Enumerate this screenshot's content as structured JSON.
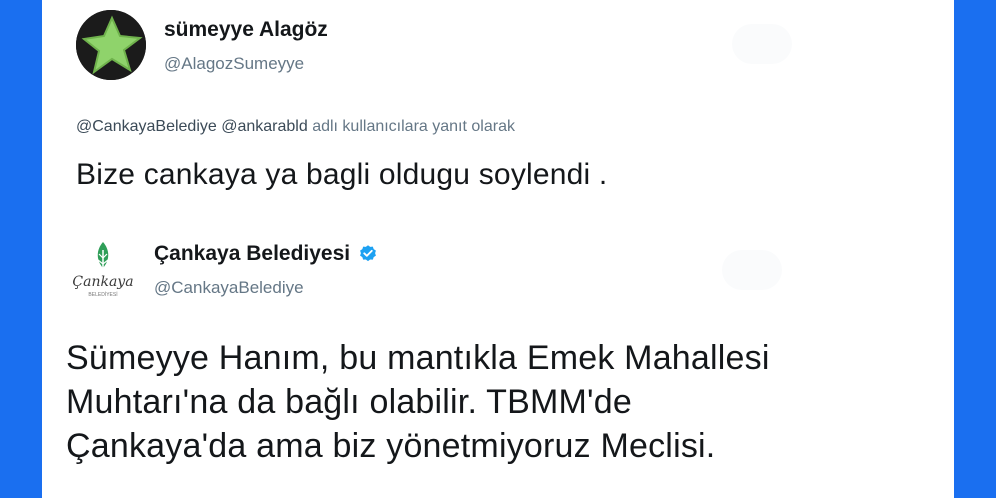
{
  "colors": {
    "frame_bg": "#1a6ff0",
    "text": "#14171a",
    "muted": "#657786",
    "verified": "#1da1f2",
    "logo_green": "#2f9e58"
  },
  "tweet1": {
    "name": "sümeyye Alagöz",
    "handle": "@AlagozSumeyye",
    "reply_mentions": "@CankayaBelediye @ankarabld",
    "reply_suffix": "adlı kullanıcılara yanıt olarak",
    "text": "Bize cankaya ya bagli oldugu soylendi ."
  },
  "tweet2": {
    "name": "Çankaya Belediyesi",
    "verified_icon": "verified-badge-icon",
    "handle": "@CankayaBelediye",
    "logo_text": "Çankaya",
    "logo_subtext": "BELEDİYESİ",
    "text_lines": [
      "Sümeyye Hanım, bu mantıkla Emek Mahallesi",
      "Muhtarı'na da bağlı olabilir. TBMM'de",
      "Çankaya'da ama biz yönetmiyoruz Meclisi."
    ]
  }
}
